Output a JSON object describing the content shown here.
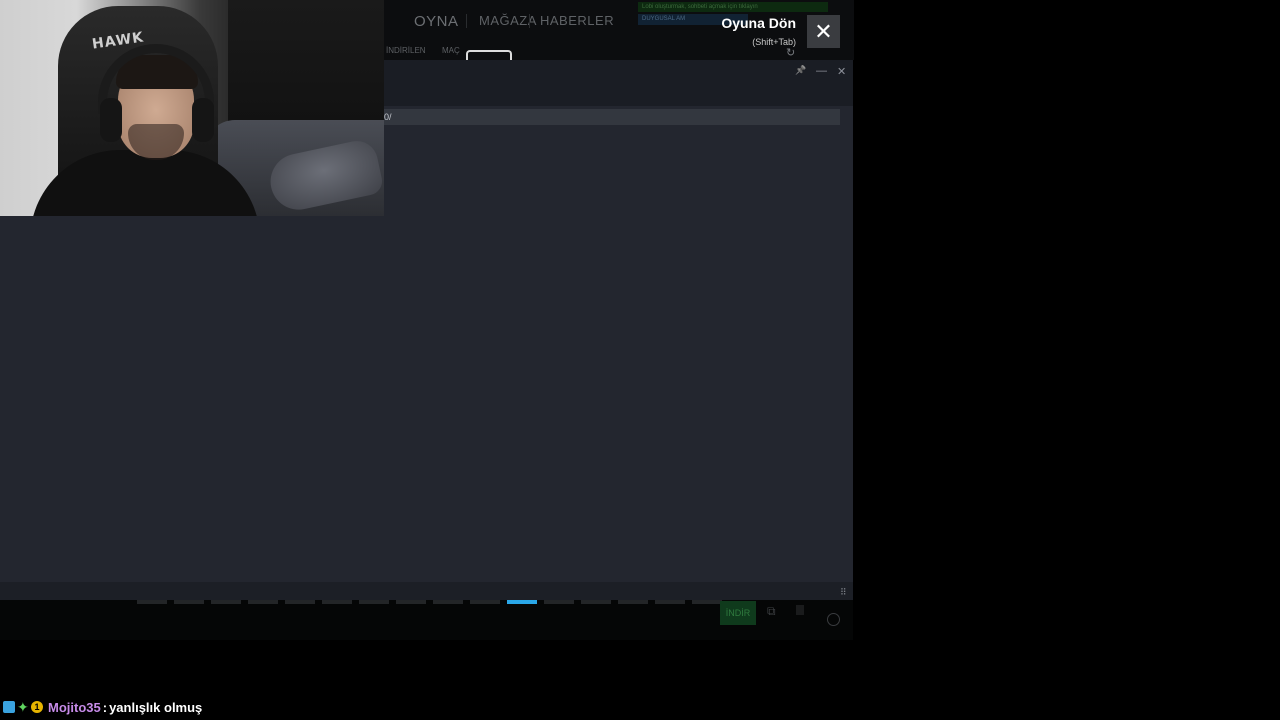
{
  "game_nav": {
    "items": [
      "OYNA",
      "MAĞAZA",
      "HABERLER"
    ],
    "sub_tabs": [
      "İNDİRİLEN",
      "MAÇ"
    ],
    "banner_green": "Lobi oluşturmak, sohbeti açmak için tıklayın",
    "banner_blue": "DUYGUSAL AM"
  },
  "overlay": {
    "return_title": "Oyuna Dön",
    "return_hint": "(Shift+Tab)",
    "close_glyph": "✕"
  },
  "browser": {
    "url_text": "0/",
    "window_buttons": {
      "pin": "📌",
      "minimize": "—",
      "close": "✕"
    }
  },
  "strip": {
    "slot_count": 16,
    "active_slot": 10,
    "indir_label": "İNDİR"
  },
  "chat": {
    "username": "Mojito35",
    "separator": ":",
    "message": "yanlışlık olmuş",
    "badge_colors": {
      "blue": "#3aa3e0",
      "green": "#5fd45f",
      "gold": "#e6b400"
    }
  }
}
